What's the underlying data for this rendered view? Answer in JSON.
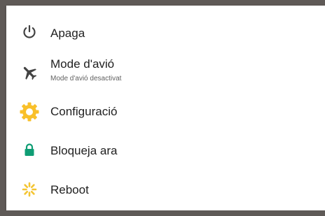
{
  "menu": {
    "items": [
      {
        "label": "Apaga",
        "icon": "power-icon",
        "icon_color": "#424242"
      },
      {
        "label": "Mode d'avió",
        "sublabel": "Mode d'avió desactivat",
        "icon": "airplane-icon",
        "icon_color": "#424242"
      },
      {
        "label": "Configuració",
        "icon": "settings-gear-icon",
        "icon_color": "#f9c02a"
      },
      {
        "label": "Bloqueja ara",
        "icon": "lock-icon",
        "icon_color": "#0f9d74"
      },
      {
        "label": "Reboot",
        "icon": "reboot-icon",
        "icon_color": "#f4c534"
      }
    ]
  }
}
